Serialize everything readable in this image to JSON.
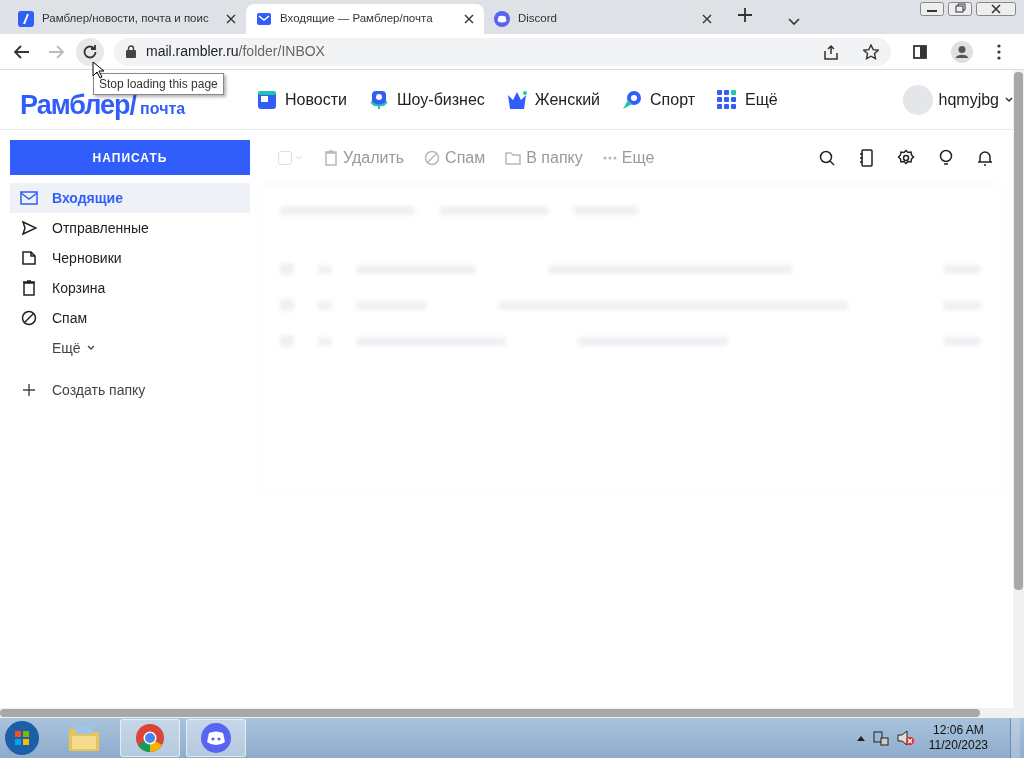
{
  "browser": {
    "tabs": [
      {
        "title": "Рамблер/новости, почта и поис",
        "kind": "rambler",
        "selected": false
      },
      {
        "title": "Входящие — Рамблер/почта",
        "kind": "mail",
        "selected": true
      },
      {
        "title": "Discord",
        "kind": "discord",
        "selected": false
      }
    ],
    "address": {
      "domain": "mail.rambler.ru",
      "path": "/folder/INBOX"
    },
    "tooltip": "Stop loading this page"
  },
  "header": {
    "logo": {
      "brand": "Рамблер/",
      "product": "почта"
    },
    "nav": [
      {
        "label": "Новости",
        "kind": "news"
      },
      {
        "label": "Шоу-бизнес",
        "kind": "show"
      },
      {
        "label": "Женский",
        "kind": "women"
      },
      {
        "label": "Спорт",
        "kind": "sport"
      },
      {
        "label": "Ещё",
        "kind": "more"
      }
    ],
    "user": "hqmyjbg"
  },
  "sidebar": {
    "compose": "НАПИСАТЬ",
    "folders": [
      {
        "label": "Входящие",
        "kind": "inbox",
        "selected": true
      },
      {
        "label": "Отправленные",
        "kind": "sent",
        "selected": false
      },
      {
        "label": "Черновики",
        "kind": "drafts",
        "selected": false
      },
      {
        "label": "Корзина",
        "kind": "trash",
        "selected": false
      },
      {
        "label": "Спам",
        "kind": "spam",
        "selected": false
      }
    ],
    "more": "Ещё",
    "create": "Создать папку"
  },
  "toolbar": {
    "actions": [
      {
        "label": "Удалить",
        "kind": "trash",
        "disabled": true
      },
      {
        "label": "Спам",
        "kind": "spam",
        "disabled": true
      },
      {
        "label": "В папку",
        "kind": "folder",
        "disabled": true
      },
      {
        "label": "Еще",
        "kind": "dots",
        "disabled": true
      }
    ],
    "tools": [
      {
        "kind": "search"
      },
      {
        "kind": "contacts"
      },
      {
        "kind": "settings"
      },
      {
        "kind": "tips"
      },
      {
        "kind": "bell"
      }
    ]
  },
  "taskbar": {
    "apps": [
      {
        "kind": "explorer",
        "selected": false
      },
      {
        "kind": "chrome",
        "selected": true
      },
      {
        "kind": "discord",
        "selected": true
      }
    ],
    "time": "12:06 AM",
    "date": "11/20/2023"
  }
}
